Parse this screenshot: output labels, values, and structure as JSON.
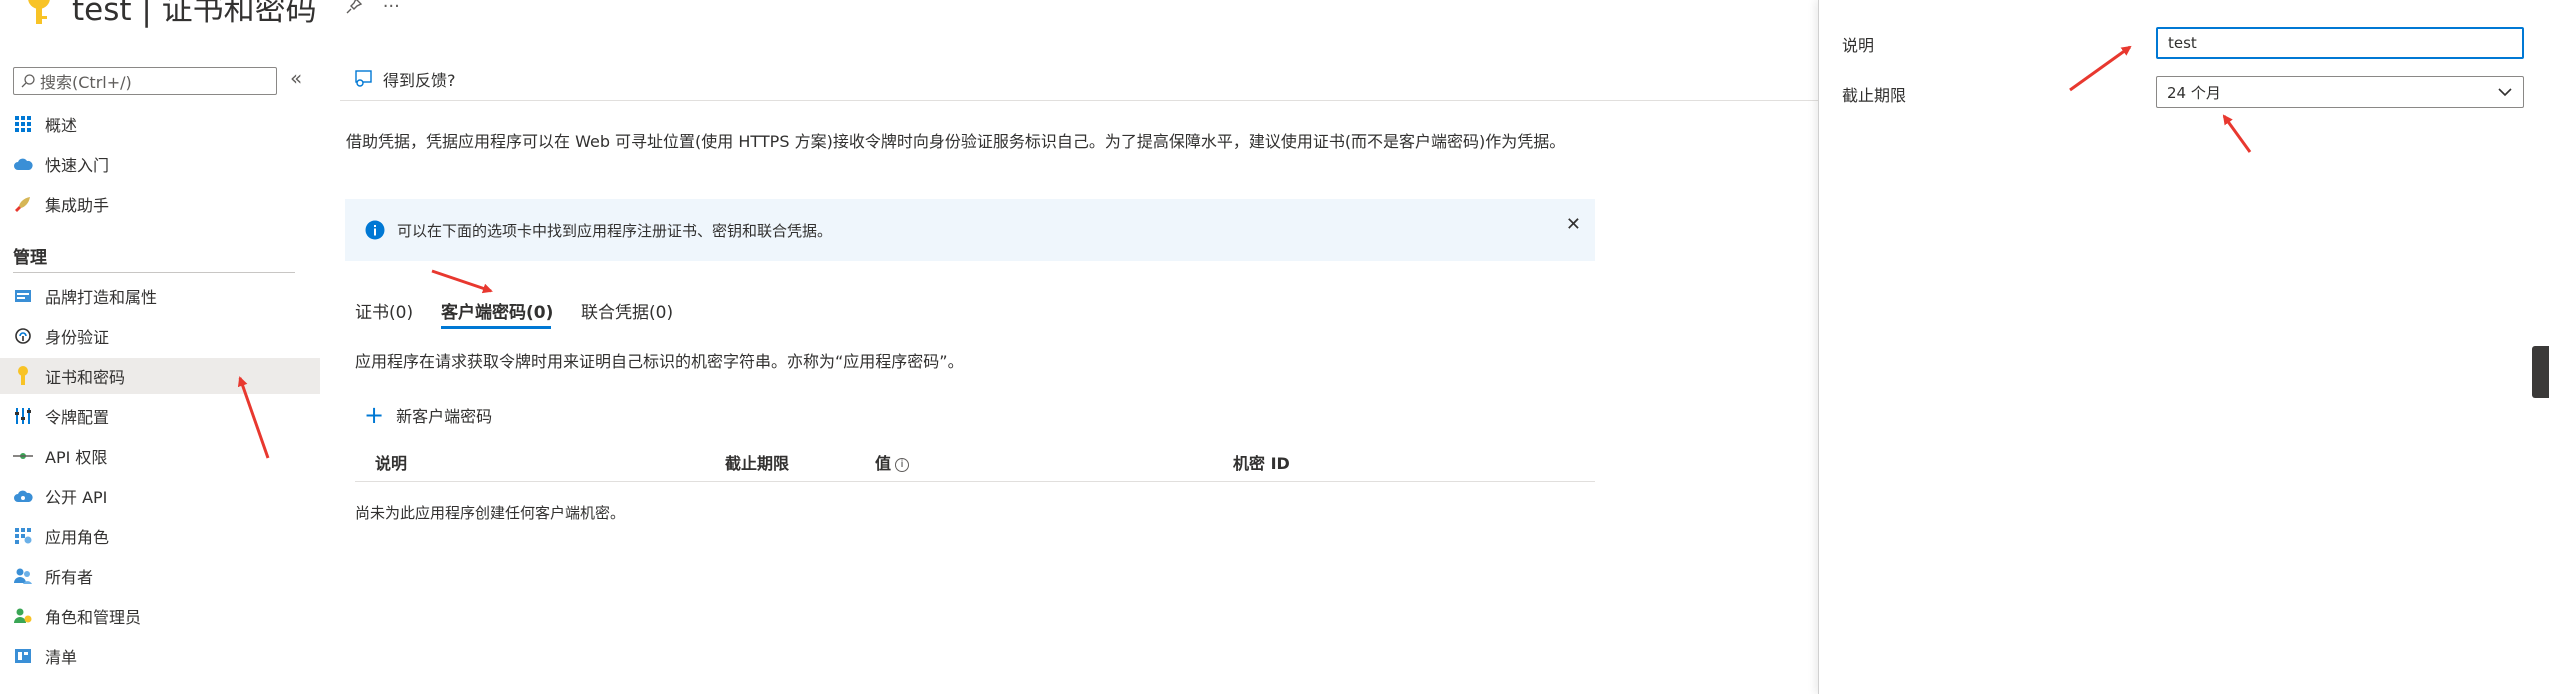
{
  "header": {
    "title": "test | 证书和密码",
    "more": "···"
  },
  "sidebar": {
    "search_placeholder": "搜索(Ctrl+/)",
    "collapse": "«",
    "items": [
      {
        "label": "概述"
      },
      {
        "label": "快速入门"
      },
      {
        "label": "集成助手"
      }
    ],
    "section_title": "管理",
    "manage_items": [
      {
        "label": "品牌打造和属性"
      },
      {
        "label": "身份验证"
      },
      {
        "label": "证书和密码"
      },
      {
        "label": "令牌配置"
      },
      {
        "label": "API 权限"
      },
      {
        "label": "公开 API"
      },
      {
        "label": "应用角色"
      },
      {
        "label": "所有者"
      },
      {
        "label": "角色和管理员"
      },
      {
        "label": "清单"
      }
    ],
    "active": "证书和密码"
  },
  "main": {
    "feedback": "得到反馈?",
    "description": "借助凭据，凭据应用程序可以在 Web 可寻址位置(使用 HTTPS 方案)接收令牌时向身份验证服务标识自己。为了提高保障水平，建议使用证书(而不是客户端密码)作为凭据。",
    "info_banner": "可以在下面的选项卡中找到应用程序注册证书、密钥和联合凭据。",
    "info_close": "✕",
    "tabs": [
      {
        "label": "证书(0)"
      },
      {
        "label": "客户端密码(0)"
      },
      {
        "label": "联合凭据(0)"
      }
    ],
    "active_tab": "客户端密码(0)",
    "tab_description": "应用程序在请求获取令牌时用来证明自己标识的机密字符串。亦称为“应用程序密码”。",
    "new_secret": "新客户端密码",
    "table": {
      "columns": [
        "说明",
        "截止期限",
        "值",
        "机密 ID"
      ],
      "empty": "尚未为此应用程序创建任何客户端机密。"
    }
  },
  "panel": {
    "description_label": "说明",
    "description_value": "test",
    "expiry_label": "截止期限",
    "expiry_value": "24 个月"
  },
  "colors": {
    "accent": "#0078d4",
    "annotation": "#e8382f",
    "info_bg": "#eff6fc",
    "key_yellow": "#f8c326"
  }
}
